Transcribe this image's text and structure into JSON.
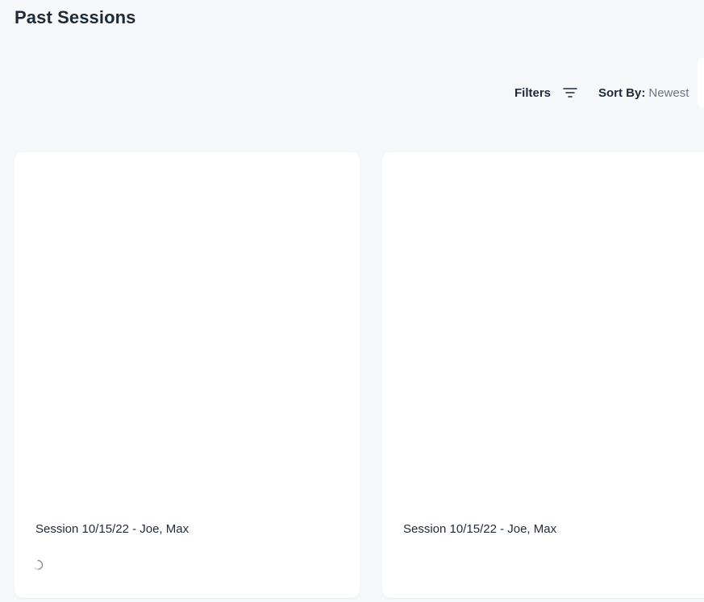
{
  "header": {
    "title": "Past Sessions"
  },
  "toolbar": {
    "filters_label": "Filters",
    "filter_icon": "filter-lines-icon",
    "sort_label": "Sort By:",
    "sort_value": "Newest"
  },
  "sessions": [
    {
      "title": "Session 10/15/22 - Joe, Max",
      "loading": true
    },
    {
      "title": "Session 10/15/22 - Joe, Max",
      "loading": false
    }
  ],
  "colors": {
    "background": "#f7f8fa",
    "card": "#ffffff",
    "text": "#1f2a37",
    "muted": "#6b7583"
  }
}
